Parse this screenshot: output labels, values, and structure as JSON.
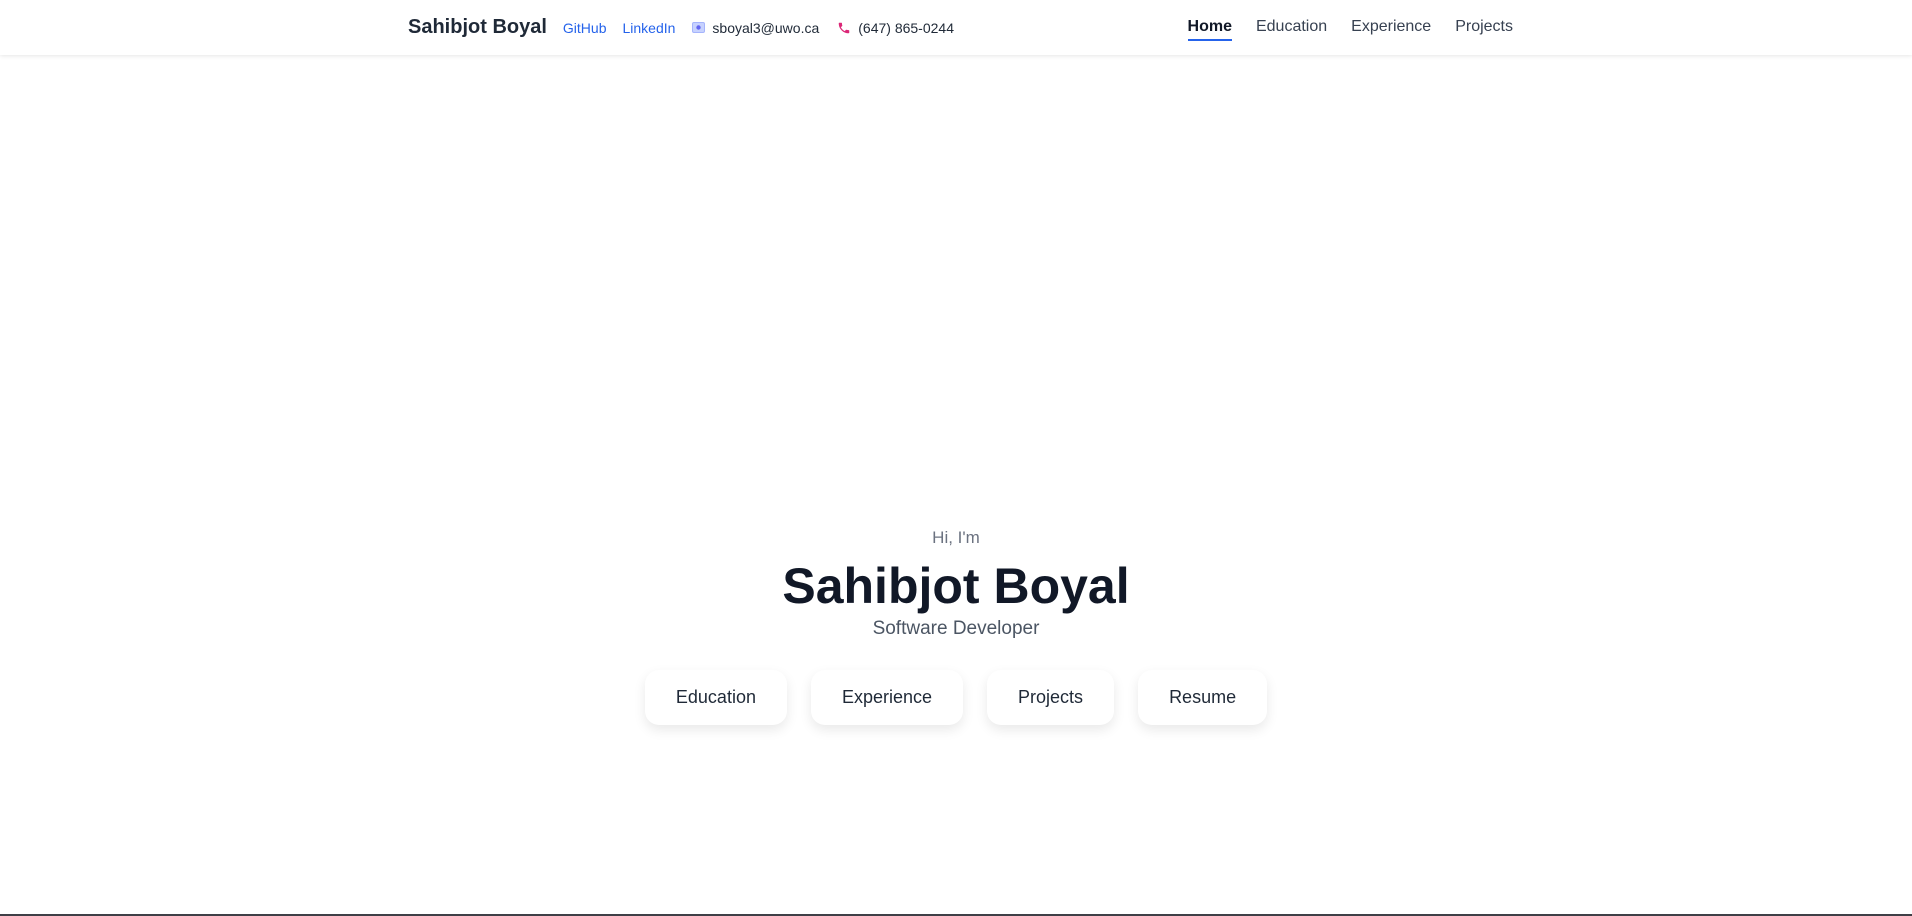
{
  "header": {
    "brand": "Sahibjot Boyal",
    "links": {
      "github": "GitHub",
      "linkedin": "LinkedIn"
    },
    "email": "sboyal3@uwo.ca",
    "phone": "(647) 865-0244",
    "nav": {
      "home": "Home",
      "education": "Education",
      "experience": "Experience",
      "projects": "Projects"
    },
    "active_nav": "Home"
  },
  "hero": {
    "greeting": "Hi, I'm",
    "name": "Sahibjot Boyal",
    "role": "Software Developer",
    "buttons": {
      "education": "Education",
      "experience": "Experience",
      "projects": "Projects",
      "resume": "Resume"
    }
  },
  "icons": {
    "email": "envelope-icon",
    "phone": "phone-icon"
  },
  "colors": {
    "link": "#2563eb",
    "nav_underline": "#2563eb",
    "phone_icon": "#db2777",
    "email_icon": "#6366f1"
  }
}
